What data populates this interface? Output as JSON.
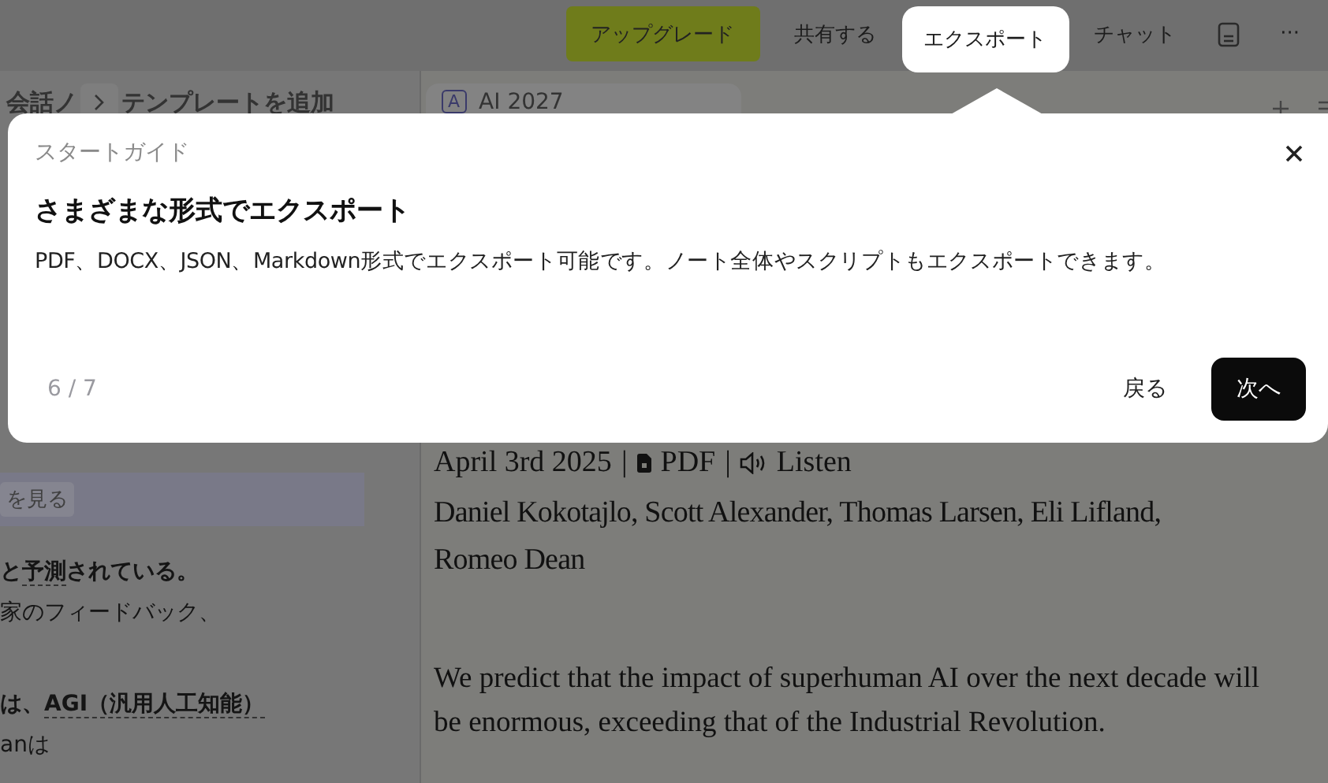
{
  "top_bar": {
    "buttons": [
      {
        "kind": "primary",
        "label": "アップグレード",
        "selected": false
      },
      {
        "kind": "text",
        "label": "共有する",
        "selected": false
      },
      {
        "kind": "text",
        "label": "エクスポート",
        "selected": true
      },
      {
        "kind": "text",
        "label": "チャット",
        "selected": false
      },
      {
        "kind": "icon",
        "selected": false
      },
      {
        "kind": "text",
        "label": "···",
        "selected": false
      }
    ]
  },
  "left_panel": {
    "heading_parts": [
      "会話ノ",
      "テンプレートを追加"
    ],
    "chip": "を見る",
    "lines": [
      {
        "bold": true,
        "segments": [
          {
            "text": "と",
            "underlined": false
          },
          {
            "text": "予測",
            "underlined": true
          },
          {
            "text": "されている。",
            "underlined": false
          }
        ]
      },
      {
        "bold": false,
        "segments": [
          {
            "text": "家のフィードバック、",
            "underlined": false
          }
        ]
      },
      {
        "bold": true,
        "segments": [
          {
            "text": "は、",
            "underlined": false
          },
          {
            "text": "AGI（汎用人工知能）",
            "underlined": true
          }
        ]
      },
      {
        "bold": false,
        "segments": [
          {
            "text": "anは",
            "underlined": false
          }
        ]
      }
    ]
  },
  "tab": {
    "badge": "A",
    "title": "AI 2027"
  },
  "article": {
    "date": "April 3rd 2025",
    "separator": "|",
    "pdf": "PDF",
    "listen": "Listen",
    "authors": "Daniel Kokotajlo, Scott Alexander, Thomas Larsen, Eli Lifland, Romeo Dean",
    "paragraph": "We predict that the impact of superhuman AI over the next decade will be enormous, exceeding that of the Industrial Revolution."
  },
  "guide": {
    "label": "スタートガイド",
    "title": "さまざまな形式でエクスポート",
    "body": "PDF、DOCX、JSON、Markdown形式でエクスポート可能です。ノート全体やスクリプトもエクスポートできます。",
    "step": "6 / 7",
    "back": "戻る",
    "next": "次へ"
  }
}
